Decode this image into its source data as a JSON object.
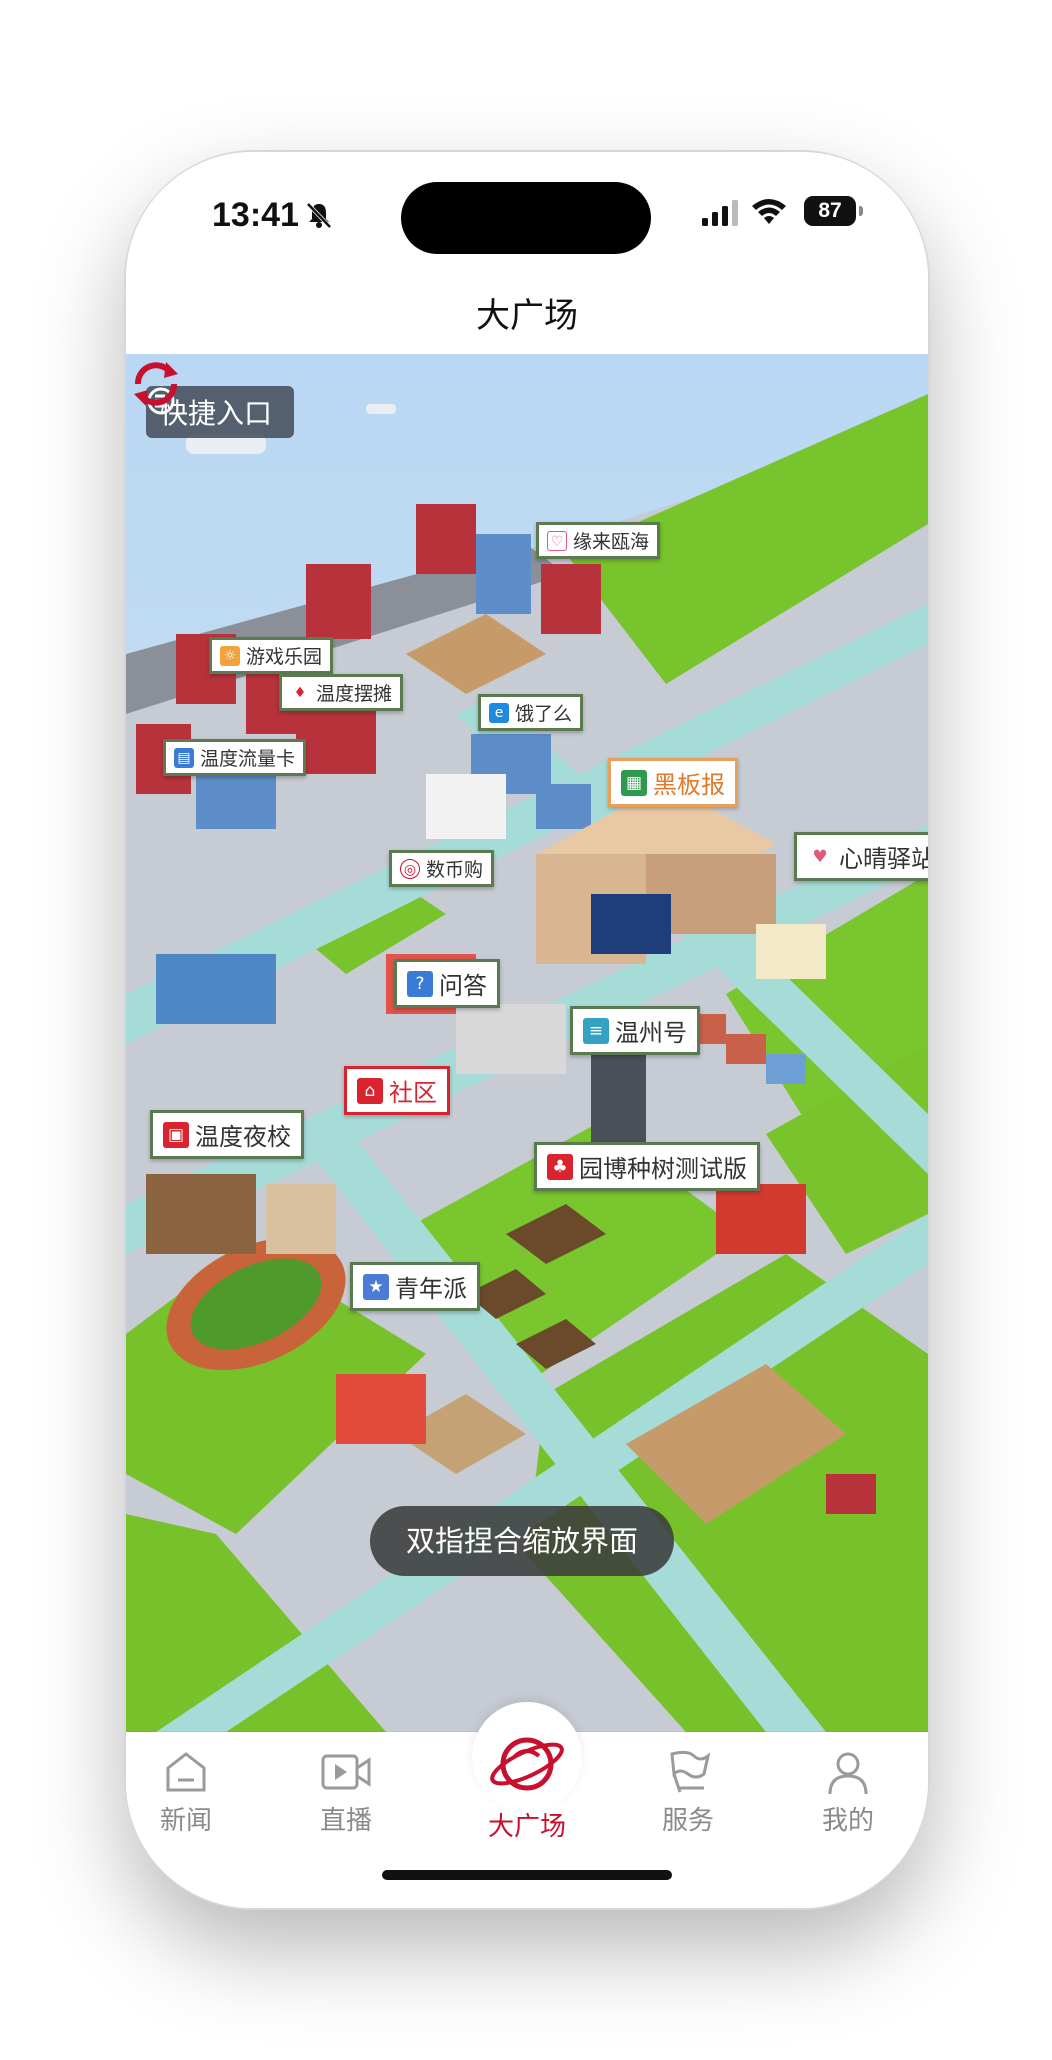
{
  "status_bar": {
    "time": "13:41",
    "battery": "87"
  },
  "nav": {
    "title": "大广场"
  },
  "map": {
    "quick_entry_label": "快捷入口",
    "labels": [
      {
        "id": "yuanlai",
        "text": "缘来瓯海",
        "color": "#e05a7a",
        "icon": "heart-icon"
      },
      {
        "id": "youxi",
        "text": "游戏乐园",
        "color": "#f2a23b",
        "icon": "game-icon"
      },
      {
        "id": "baitan",
        "text": "温度摆摊",
        "color": "#d9232e",
        "icon": "stall-icon"
      },
      {
        "id": "liuliang",
        "text": "温度流量卡",
        "color": "#3a7bd5",
        "icon": "sim-card-icon"
      },
      {
        "id": "eleme",
        "text": "饿了么",
        "color": "#1e8be0",
        "icon": "eleme-icon"
      },
      {
        "id": "heiban",
        "text": "黑板报",
        "color": "#2f9a4c",
        "icon": "blackboard-icon"
      },
      {
        "id": "shubi",
        "text": "数币购",
        "color": "#c8102e",
        "icon": "coin-icon"
      },
      {
        "id": "xinqing",
        "text": "心晴驿站",
        "color": "#e05a7a",
        "icon": "heart-icon"
      },
      {
        "id": "wenda",
        "text": "问答",
        "color": "#3a7bd5",
        "icon": "qa-icon"
      },
      {
        "id": "wenzhou",
        "text": "温州号",
        "color": "#33a2c4",
        "icon": "news-icon"
      },
      {
        "id": "shequ",
        "text": "社区",
        "color": "#d9232e",
        "icon": "house-icon"
      },
      {
        "id": "yebo",
        "text": "园博种树测试版",
        "color": "#d9232e",
        "icon": "tree-icon"
      },
      {
        "id": "yexiao",
        "text": "温度夜校",
        "color": "#d9232e",
        "icon": "school-icon"
      },
      {
        "id": "qingnian",
        "text": "青年派",
        "color": "#4b7bd5",
        "icon": "youth-icon"
      }
    ]
  },
  "toast": {
    "text": "双指捏合缩放界面"
  },
  "tabbar": {
    "items": [
      {
        "label": "新闻",
        "icon": "news-tab-icon",
        "active": false
      },
      {
        "label": "直播",
        "icon": "live-video-icon",
        "active": false
      },
      {
        "label": "大广场",
        "icon": "planet-icon",
        "active": true
      },
      {
        "label": "服务",
        "icon": "flag-icon",
        "active": false
      },
      {
        "label": "我的",
        "icon": "person-icon",
        "active": false
      }
    ]
  },
  "colors": {
    "accent": "#c8102e",
    "grass": "#7ac62e",
    "road": "#c8ccd4",
    "water": "#a9cdea"
  }
}
